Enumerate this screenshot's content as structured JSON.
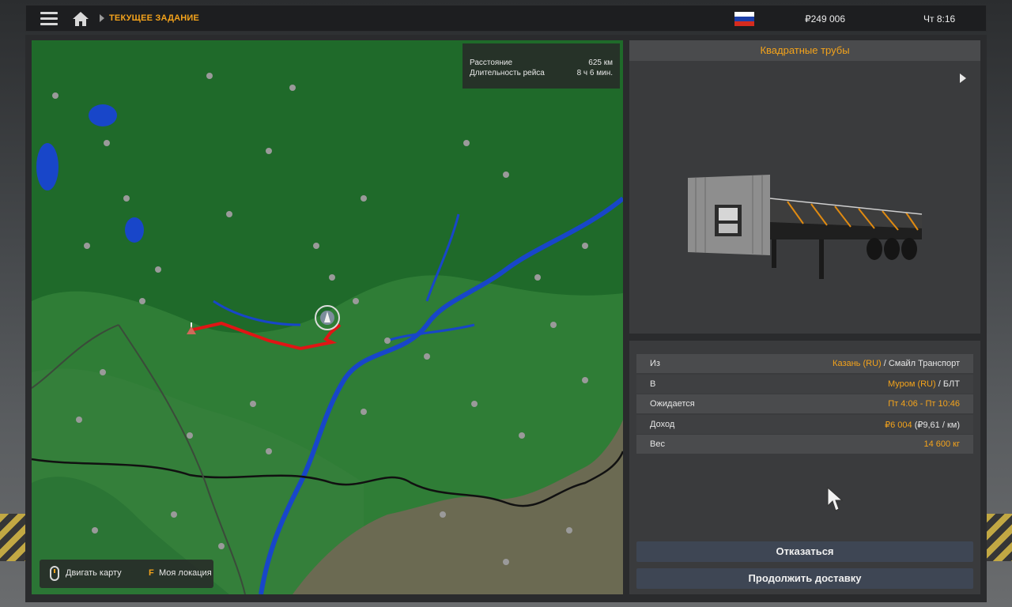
{
  "topbar": {
    "breadcrumb": "ТЕКУЩЕЕ ЗАДАНИЕ",
    "money": "₽249 006",
    "time": "Чт 8:16",
    "flag_colors": [
      "#ffffff",
      "#1c3fa8",
      "#d52b1e"
    ]
  },
  "route_info": {
    "distance_label": "Расстояние",
    "distance_value": "625 км",
    "duration_label": "Длительность рейса",
    "duration_value": "8 ч 6 мин."
  },
  "map_hint": {
    "move_label": "Двигать карту",
    "location_key": "F",
    "location_label": "Моя локация"
  },
  "cargo": {
    "title": "Квадратные трубы"
  },
  "details": {
    "from_label": "Из",
    "from_city": "Казань (RU)",
    "from_company": " / Смайл Транспорт",
    "to_label": "В",
    "to_city": "Муром (RU)",
    "to_company": " / БЛТ",
    "expected_label": "Ожидается",
    "expected_value": "Пт 4:06 - Пт 10:46",
    "income_label": "Доход",
    "income_value": "₽6 004",
    "income_rate": " (₽9,61 / км)",
    "weight_label": "Вес",
    "weight_value": "14 600 кг"
  },
  "buttons": {
    "cancel": "Отказаться",
    "continue": "Продолжить доставку"
  },
  "colors": {
    "accent": "#f4a31b",
    "map_forest": "#1f6a2a",
    "map_light": "#2f7d36",
    "map_steppe": "#6b6a52",
    "water": "#1846c9",
    "route": "#e01515"
  }
}
